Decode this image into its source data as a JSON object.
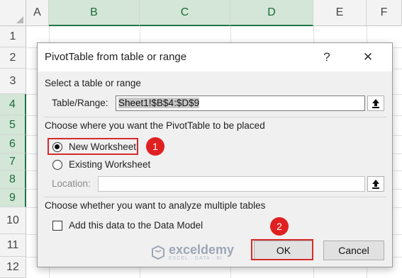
{
  "sheet": {
    "columns": [
      "A",
      "B",
      "C",
      "D",
      "E",
      "F"
    ],
    "rows": [
      "1",
      "2",
      "3",
      "4",
      "5",
      "6",
      "7",
      "8",
      "9",
      "10",
      "11",
      "12"
    ]
  },
  "dialog": {
    "title": "PivotTable from table or range",
    "help_label": "?",
    "close_label": "✕",
    "select_section": "Select a table or range",
    "table_range_label": "Table/Range:",
    "table_range_value": "Sheet1!$B$4:$D$9",
    "placement_section": "Choose where you want the PivotTable to be placed",
    "new_worksheet": "New Worksheet",
    "existing_worksheet": "Existing Worksheet",
    "location_label": "Location:",
    "location_value": "",
    "multiple_section": "Choose whether you want to analyze multiple tables",
    "data_model": "Add this data to the Data Model",
    "ok": "OK",
    "cancel": "Cancel",
    "selected_option": "New Worksheet",
    "data_model_checked": false
  },
  "annotations": {
    "step1": "1",
    "step2": "2",
    "color": "#e02020"
  },
  "watermark": {
    "name": "exceldemy",
    "tagline": "EXCEL · DATA · BI"
  },
  "icons": [
    "upload-arrow-icon",
    "close-icon",
    "help-icon",
    "exceldemy-logo-icon"
  ]
}
